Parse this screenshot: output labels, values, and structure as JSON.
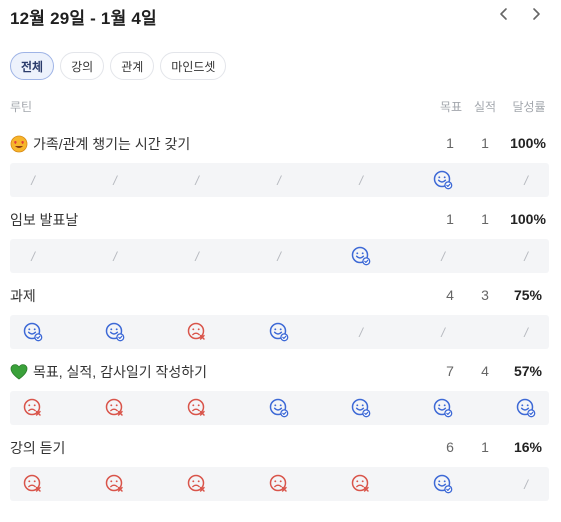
{
  "header": {
    "date_range": "12월 29일 - 1월 4일"
  },
  "tabs": [
    {
      "label": "전체",
      "active": true
    },
    {
      "label": "강의",
      "active": false
    },
    {
      "label": "관계",
      "active": false
    },
    {
      "label": "마인드셋",
      "active": false
    }
  ],
  "columns": {
    "routine": "루틴",
    "goal": "목표",
    "actual": "실적",
    "rate": "달성률"
  },
  "colors": {
    "success": "#3d69d6",
    "fail": "#d9544a",
    "empty": "#b6b9bf",
    "row_bg": "#f4f5f7"
  },
  "routines": [
    {
      "title": "가족/관계 챙기는 시간 갖기",
      "emoji": "smiling-face-with-heart-eyes-icon",
      "goal": "1",
      "actual": "1",
      "rate": "100%",
      "days": [
        "empty",
        "empty",
        "empty",
        "empty",
        "empty",
        "success",
        "empty"
      ]
    },
    {
      "title": "임보 발표날",
      "emoji": "",
      "goal": "1",
      "actual": "1",
      "rate": "100%",
      "days": [
        "empty",
        "empty",
        "empty",
        "empty",
        "success",
        "empty",
        "empty"
      ]
    },
    {
      "title": "과제",
      "emoji": "",
      "goal": "4",
      "actual": "3",
      "rate": "75%",
      "days": [
        "success",
        "success",
        "fail",
        "success",
        "empty",
        "empty",
        "empty"
      ]
    },
    {
      "title": "목표, 실적, 감사일기 작성하기",
      "emoji": "green-heart-icon",
      "goal": "7",
      "actual": "4",
      "rate": "57%",
      "days": [
        "fail",
        "fail",
        "fail",
        "success",
        "success",
        "success",
        "success"
      ]
    },
    {
      "title": "강의 듣기",
      "emoji": "",
      "goal": "6",
      "actual": "1",
      "rate": "16%",
      "days": [
        "fail",
        "fail",
        "fail",
        "fail",
        "fail",
        "success",
        "empty"
      ]
    }
  ]
}
